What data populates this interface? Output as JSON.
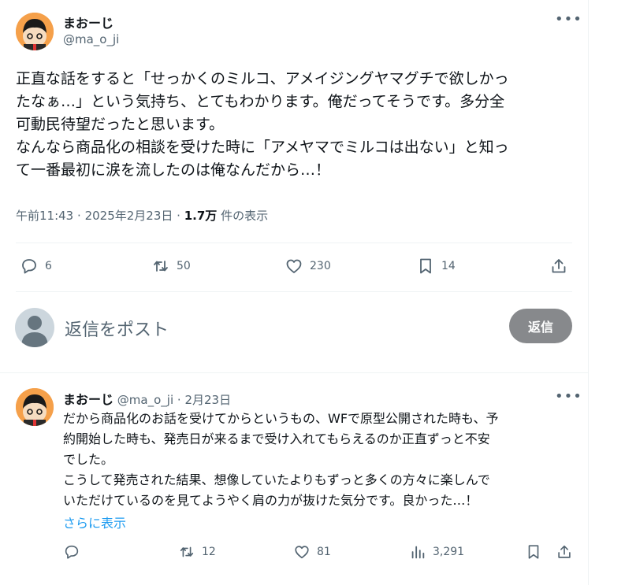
{
  "main_tweet": {
    "display_name": "まおーじ",
    "handle": "@ma_o_ji",
    "text_lines": [
      "正直な話をすると「せっかくのミルコ、アメイジングヤマグチで欲しかっ",
      "たなぁ…」という気持ち、とてもわかります。俺だってそうです。多分全",
      "可動民待望だったと思います。",
      "なんなら商品化の相談を受けた時に「アメヤマでミルコは出ない」と知っ",
      "て一番最初に涙を流したのは俺なんだから…！"
    ],
    "time": "午前11:43",
    "date": "2025年2月23日",
    "views_count": "1.7万",
    "views_label": "件の表示",
    "stats": {
      "replies": "6",
      "reposts": "50",
      "likes": "230",
      "bookmarks": "14"
    }
  },
  "composer": {
    "placeholder": "返信をポスト",
    "reply_button": "返信"
  },
  "reply_tweet": {
    "display_name": "まおーじ",
    "handle": "@ma_o_ji",
    "date": "2月23日",
    "text_lines": [
      "だから商品化のお話を受けてからというもの、WFで原型公開された時も、予",
      "約開始した時も、発売日が来るまで受け入れてもらえるのか正直ずっと不安",
      "でした。",
      "こうして発売された結果、想像していたよりもずっと多くの方々に楽しんで",
      "いただけているのを見てようやく肩の力が抜けた気分です。良かった…！"
    ],
    "show_more": "さらに表示",
    "stats": {
      "reposts": "12",
      "likes": "81",
      "views": "3,291"
    }
  },
  "icons": {
    "reply": "reply-icon",
    "repost": "repost-icon",
    "like": "heart-icon",
    "bookmark": "bookmark-icon",
    "share": "share-icon",
    "views": "analytics-icon",
    "more": "more-icon"
  },
  "colors": {
    "accent": "#1d9bf0",
    "text": "#0f1419",
    "muted": "#536471",
    "avatar_bg": "#f5a04a",
    "reply_button_bg": "#87898c"
  }
}
